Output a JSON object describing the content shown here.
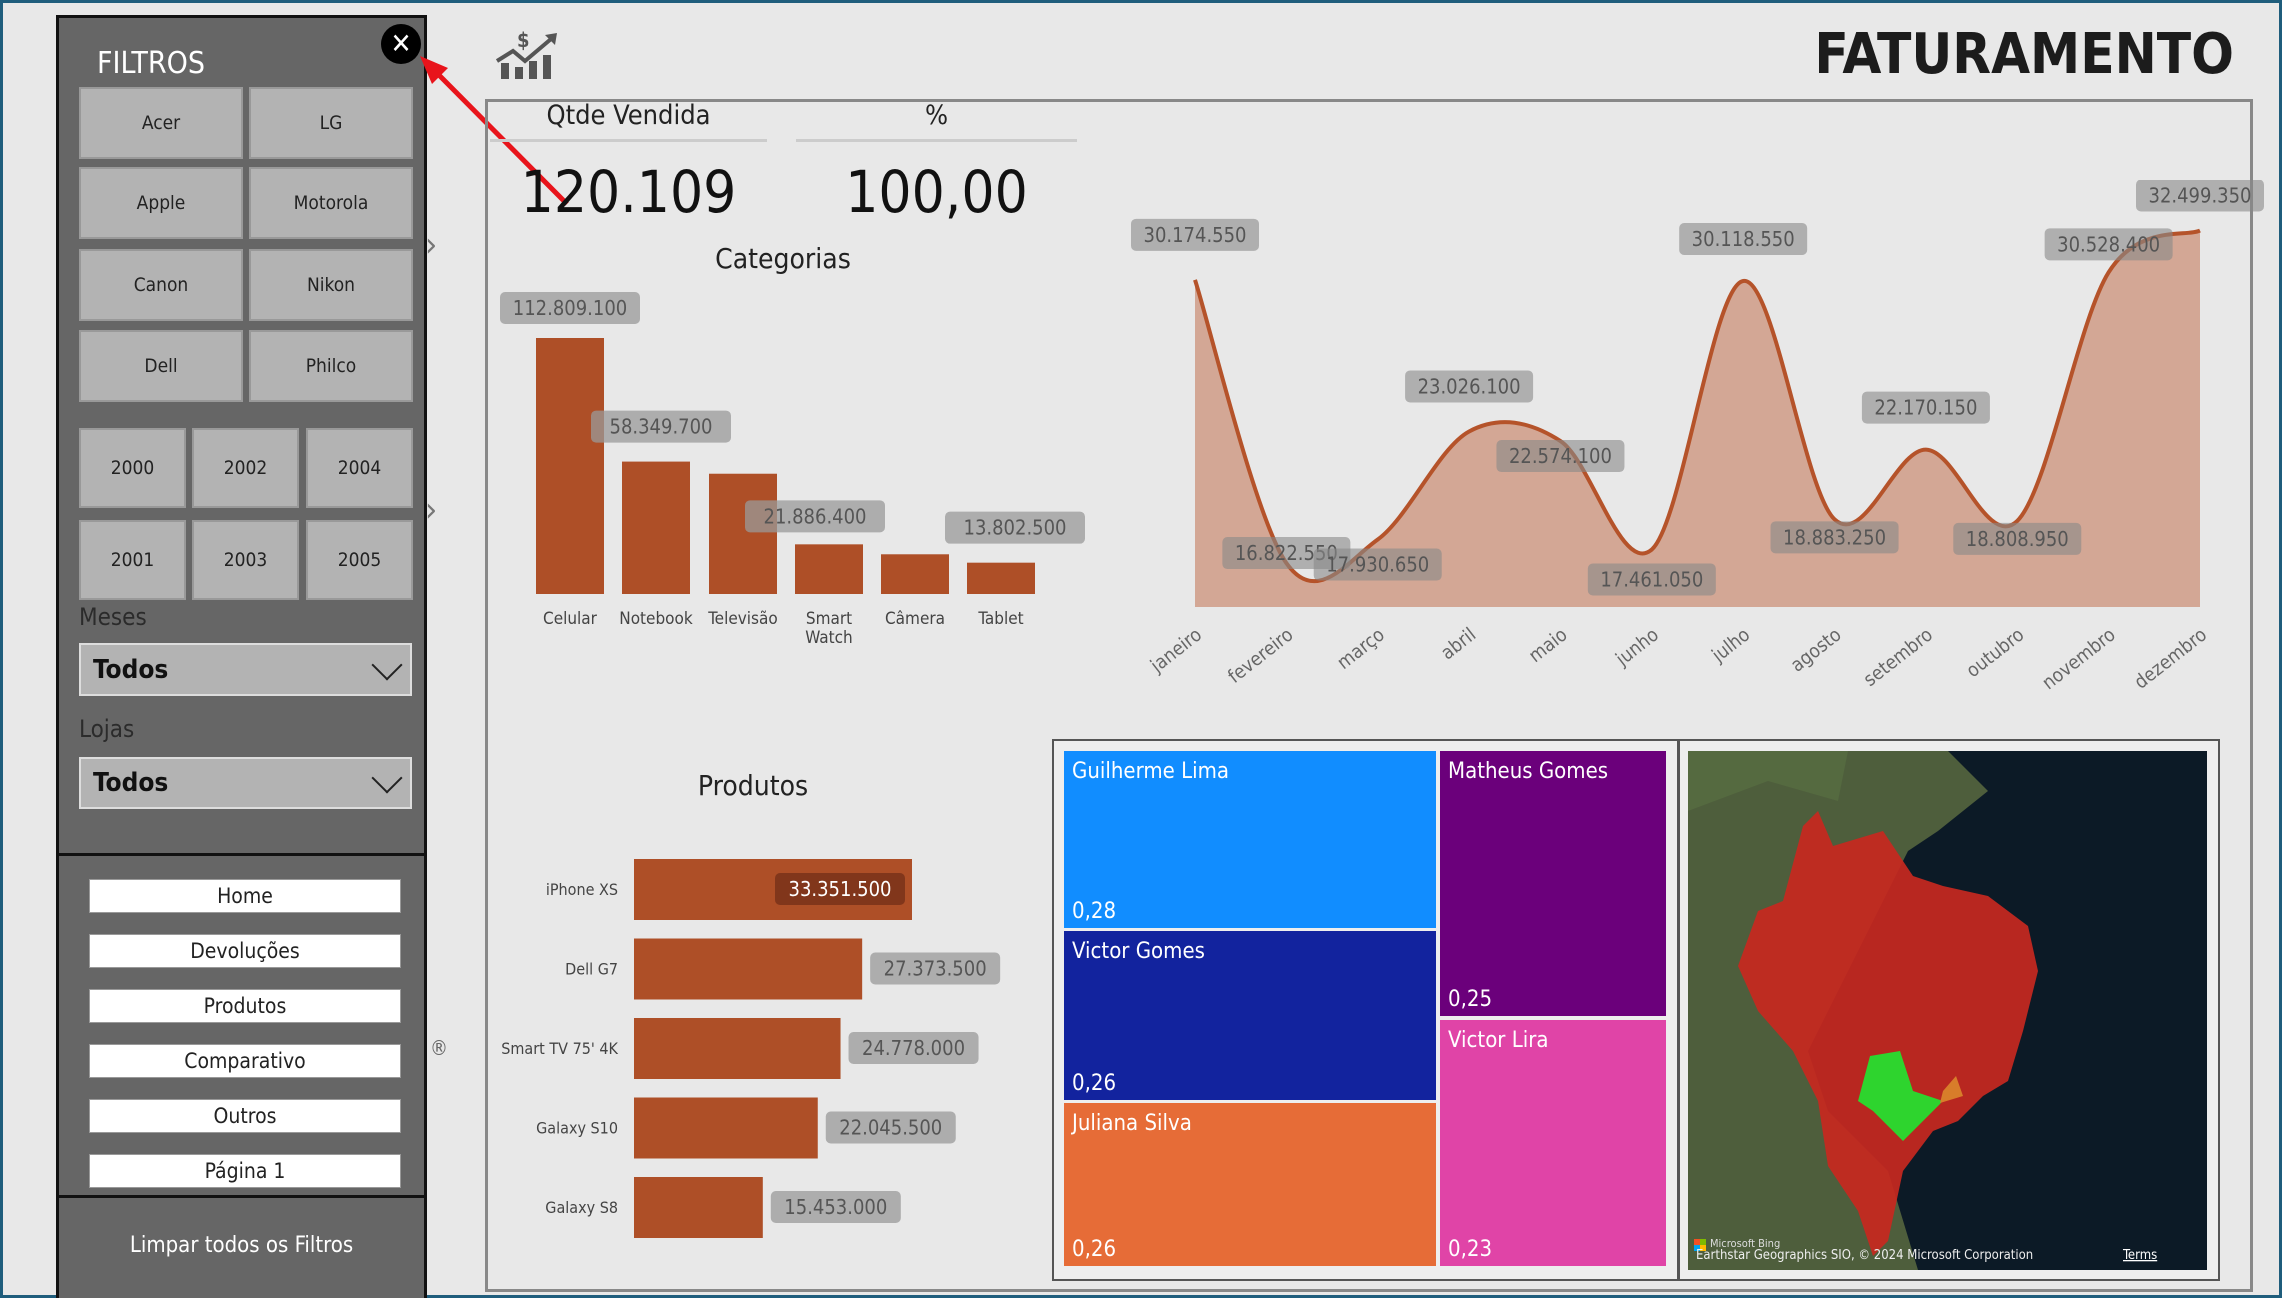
{
  "header": {
    "title": "FATURAMENTO",
    "icon": "money-growth-chart-icon"
  },
  "filters": {
    "title": "FILTROS",
    "close_icon": "close-icon",
    "brands": [
      "Acer",
      "LG",
      "Apple",
      "Motorola",
      "Canon",
      "Nikon",
      "Dell",
      "Philco"
    ],
    "years": [
      "2000",
      "2002",
      "2004",
      "2001",
      "2003",
      "2005"
    ],
    "months_label": "Meses",
    "months_value": "Todos",
    "stores_label": "Lojas",
    "stores_value": "Todos",
    "nav": [
      "Home",
      "Devoluções",
      "Produtos",
      "Comparativo",
      "Outros",
      "Página 1"
    ],
    "clear_label": "Limpar todos os Filtros",
    "registered_mark": "®"
  },
  "kpis": [
    {
      "label": "Qtde Vendida",
      "value": "120.109"
    },
    {
      "label": "%",
      "value": "100,00"
    }
  ],
  "colors": {
    "bar": "#ae4f27",
    "area": "#d3a795",
    "line": "#b5532a",
    "annotation_arrow": "#e8141b",
    "panel": "#666666"
  },
  "chart_data": [
    {
      "type": "bar",
      "title": "Categorias",
      "categories": [
        "Celular",
        "Notebook",
        "Televisão",
        "Smart Watch",
        "Câmera",
        "Tablet"
      ],
      "values": [
        112809100,
        58349700,
        null,
        21886400,
        null,
        13802500
      ],
      "labels": [
        "112.809.100",
        "58.349.700",
        "",
        "21.886.400",
        "",
        "13.802.500"
      ],
      "approx_values": [
        112809100,
        58349700,
        53000000,
        21886400,
        17500000,
        13802500
      ]
    },
    {
      "type": "area",
      "categories": [
        "janeiro",
        "fevereiro",
        "março",
        "abril",
        "maio",
        "junho",
        "julho",
        "agosto",
        "setembro",
        "outubro",
        "novembro",
        "dezembro"
      ],
      "values": [
        30174550,
        16822550,
        17930650,
        23026100,
        22574100,
        17461050,
        30118550,
        18883250,
        22170150,
        18808950,
        30528400,
        32499350
      ],
      "labels": [
        "30.174.550",
        "16.822.550",
        "17.930.650",
        "23.026.100",
        "22.574.100",
        "17.461.050",
        "30.118.550",
        "18.883.250",
        "22.170.150",
        "18.808.950",
        "30.528.400",
        "32.499.350"
      ],
      "ylim": [
        14750000,
        33750000
      ]
    },
    {
      "type": "bar",
      "orientation": "horizontal",
      "title": "Produtos",
      "categories": [
        "iPhone XS",
        "Dell G7",
        "Smart TV 75' 4K",
        "Galaxy S10",
        "Galaxy S8"
      ],
      "values": [
        33351500,
        27373500,
        24778000,
        22045500,
        15453000
      ],
      "labels": [
        "33.351.500",
        "27.373.500",
        "24.778.000",
        "22.045.500",
        "15.453.000"
      ]
    },
    {
      "type": "treemap",
      "items": [
        {
          "name": "Guilherme Lima",
          "value": "0,28",
          "color": "#118dff"
        },
        {
          "name": "Victor Gomes",
          "value": "0,26",
          "color": "#12239e"
        },
        {
          "name": "Juliana Silva",
          "value": "0,26",
          "color": "#e66c37"
        },
        {
          "name": "Matheus Gomes",
          "value": "0,25",
          "color": "#6b007b"
        },
        {
          "name": "Victor Lira",
          "value": "0,23",
          "color": "#e044a7"
        }
      ]
    }
  ],
  "map": {
    "attribution": "Earthstar Geographics SIO, © 2024 Microsoft Corporation",
    "terms": "Terms",
    "logo": "Microsoft Bing"
  }
}
